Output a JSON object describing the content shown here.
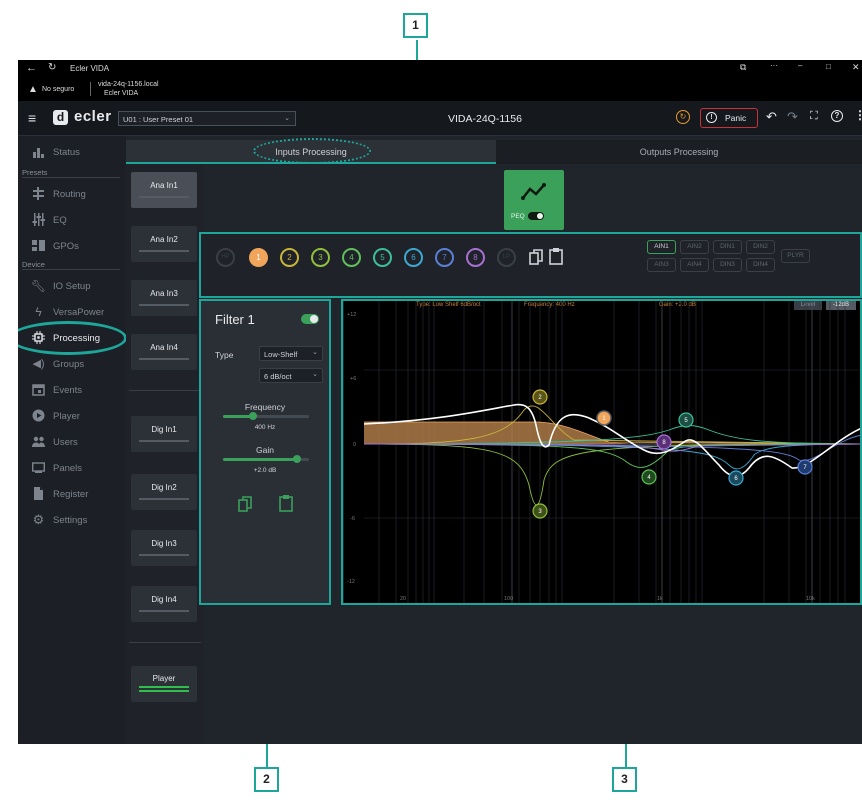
{
  "window": {
    "title": "Ecler VIDA",
    "security": "No seguro",
    "url": "vida-24q-1156.local",
    "site_name": "Ecler VIDA"
  },
  "toolbar": {
    "logo": "ecler",
    "preset": "U01 : User Preset 01",
    "device_name": "VIDA-24Q-1156",
    "panic_label": "Panic"
  },
  "sidebar": {
    "status": "Status",
    "presets_section": "Presets",
    "routing": "Routing",
    "eq": "EQ",
    "gpos": "GPOs",
    "device_section": "Device",
    "io_setup": "IO Setup",
    "versapower": "VersaPower",
    "processing": "Processing",
    "groups": "Groups",
    "events": "Events",
    "player": "Player",
    "users": "Users",
    "panels": "Panels",
    "register": "Register",
    "settings": "Settings"
  },
  "tabs": {
    "inputs": "Inputs Processing",
    "outputs": "Outputs Processing"
  },
  "channels": [
    "Ana In1",
    "Ana In2",
    "Ana In3",
    "Ana In4",
    "Dig In1",
    "Dig In2",
    "Dig In3",
    "Dig In4",
    "Player"
  ],
  "peq": {
    "label": "PEQ",
    "enabled": true
  },
  "bands": {
    "hp_label": "HP",
    "lp_label": "LP",
    "numbers": [
      "1",
      "2",
      "3",
      "4",
      "5",
      "6",
      "7",
      "8"
    ],
    "colors": [
      "#f0a55a",
      "#c8b438",
      "#8fbf3c",
      "#5fbf5a",
      "#3cbf9a",
      "#3ca8cf",
      "#5b7fd6",
      "#a76fd0"
    ],
    "selected": "1"
  },
  "channel_links": [
    "AIN1",
    "AIN2",
    "DIN1",
    "DIN2",
    "AIN3",
    "AIN4",
    "DIN3",
    "DIN4",
    "PLYR"
  ],
  "filter": {
    "title": "Filter 1",
    "enabled": true,
    "type_label": "Type",
    "type_value": "Low-Shelf",
    "slope_value": "6 dB/oct",
    "frequency_label": "Frequency",
    "frequency_value": "400 Hz",
    "frequency_level": 0.35,
    "gain_label": "Gain",
    "gain_value": "+2.0 dB",
    "gain_level": 0.86
  },
  "graph_info": {
    "type": "Type: Low Shelf 6dB/oct",
    "frequency": "Frequency: 400 Hz",
    "gain": "Gain: +2.0 dB",
    "level_label": "Level",
    "level_value": "-12dB",
    "y_ticks": [
      "+12",
      "+6",
      "0",
      "-6",
      "-12"
    ],
    "x_ticks": [
      "20",
      "100",
      "1k",
      "10k"
    ]
  },
  "callouts": [
    "1",
    "2",
    "3"
  ]
}
